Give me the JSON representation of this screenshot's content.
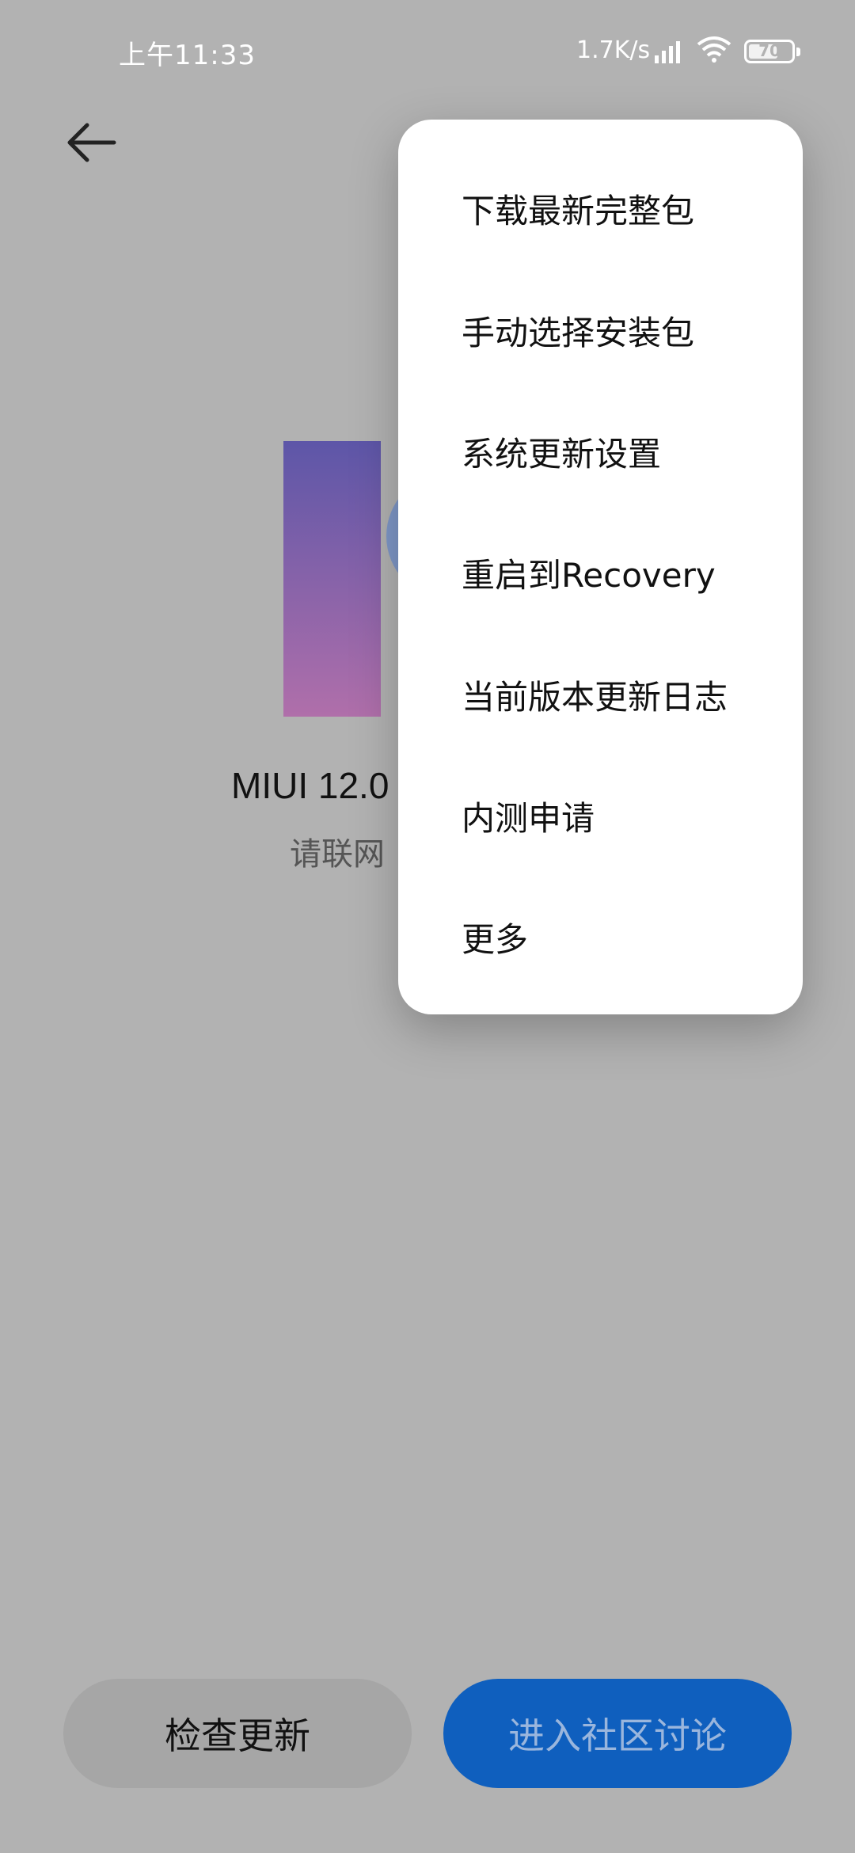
{
  "status": {
    "time": "上午11:33",
    "net_speed": "1.7K/s",
    "battery_level": "70"
  },
  "main": {
    "version": "MIUI 12.0",
    "subtitle": "请联网"
  },
  "menu": {
    "items": [
      {
        "label": "下载最新完整包"
      },
      {
        "label": "手动选择安装包"
      },
      {
        "label": "系统更新设置"
      },
      {
        "label": "重启到Recovery"
      },
      {
        "label": "当前版本更新日志"
      },
      {
        "label": "内测申请"
      },
      {
        "label": "更多"
      }
    ]
  },
  "buttons": {
    "check_update": "检查更新",
    "community": "进入社区讨论"
  },
  "colors": {
    "primary": "#0f5fbe",
    "backdrop": "#b2b2b2"
  }
}
